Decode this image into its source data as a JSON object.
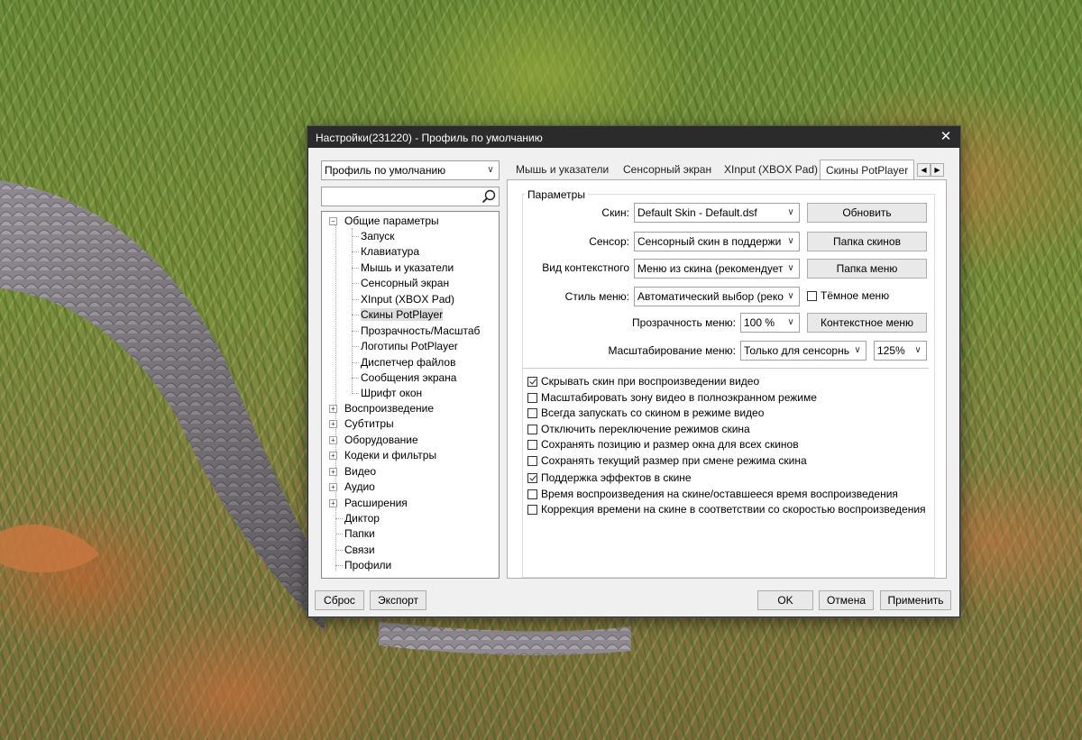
{
  "window": {
    "title": "Настройки(231220) - Профиль по умолчанию",
    "close_glyph": "✕"
  },
  "profile_combo": {
    "value": "Профиль по умолчанию"
  },
  "search": {
    "value": ""
  },
  "tree": {
    "expanded_root": "Общие параметры",
    "children": [
      "Запуск",
      "Клавиатура",
      "Мышь и указатели",
      "Сенсорный экран",
      "XInput (XBOX Pad)",
      "Скины PotPlayer",
      "Прозрачность/Масштаб",
      "Логотипы PotPlayer",
      "Диспетчер файлов",
      "Сообщения экрана",
      "Шрифт окон"
    ],
    "selected": "Скины PotPlayer",
    "collapsed_roots": [
      "Воспроизведение",
      "Субтитры",
      "Оборудование",
      "Кодеки и фильтры",
      "Видео",
      "Аудио",
      "Расширения"
    ],
    "leaf_roots": [
      "Диктор",
      "Папки",
      "Связи",
      "Профили"
    ]
  },
  "tabs": [
    {
      "label": "Мышь и указатели",
      "active": false
    },
    {
      "label": "Сенсорный экран",
      "active": false
    },
    {
      "label": "XInput (XBOX Pad)",
      "active": false
    },
    {
      "label": "Скины PotPlayer",
      "active": true
    }
  ],
  "panel": {
    "group_title": "Параметры",
    "skin_label": "Скин:",
    "skin_value": "Default Skin - Default.dsf",
    "refresh_button": "Обновить",
    "sensor_label": "Сенсор:",
    "sensor_value": "Сенсорный скин в поддержи",
    "skins_folder_button": "Папка скинов",
    "context_label": "Вид контекстного",
    "context_value": "Меню из скина (рекомендует",
    "menu_folder_button": "Папка меню",
    "menu_style_label": "Стиль меню:",
    "menu_style_value": "Автоматический выбор (реко",
    "dark_menu_label": "Тёмное меню",
    "dark_menu_checked": false,
    "transparency_label": "Прозрачность меню:",
    "transparency_value": "100 %",
    "context_menu_button": "Контекстное меню",
    "scaling_label": "Масштабирование меню:",
    "scaling_mode_value": "Только для сенсорнь",
    "scaling_percent_value": "125%",
    "checkboxes": [
      {
        "label": "Скрывать скин при воспроизведении видео",
        "checked": true
      },
      {
        "label": "Масштабировать зону видео в полноэкранном режиме",
        "checked": false
      },
      {
        "label": "Всегда запускать со скином в режиме видео",
        "checked": false
      },
      {
        "label": "Отключить переключение режимов скина",
        "checked": false
      },
      {
        "label": "Сохранять позицию и размер окна для всех скинов",
        "checked": false
      },
      {
        "label": "Сохранять текущий размер при смене режима скина",
        "checked": false
      },
      {
        "label": "Поддержка эффектов в скине",
        "checked": true
      },
      {
        "label": "Время воспроизведения на скине/оставшееся время воспроизведения",
        "checked": false
      },
      {
        "label": "Коррекция времени на скине в соответствии со скоростью воспроизведения",
        "checked": false
      }
    ]
  },
  "footer": {
    "reset_button": "Сброс",
    "export_button": "Экспорт",
    "ok_button": "OK",
    "cancel_button": "Отмена",
    "apply_button": "Применить"
  },
  "colors": {
    "titlebar": "#2b2b2b",
    "dialog_bg": "#f0f0f0",
    "selection": "#dddddd"
  },
  "icons": {
    "search": "search-icon",
    "close": "close-icon",
    "dropdown": "chevron-down-icon",
    "tree_expand": "plus-box-icon",
    "tree_collapse": "minus-box-icon"
  }
}
